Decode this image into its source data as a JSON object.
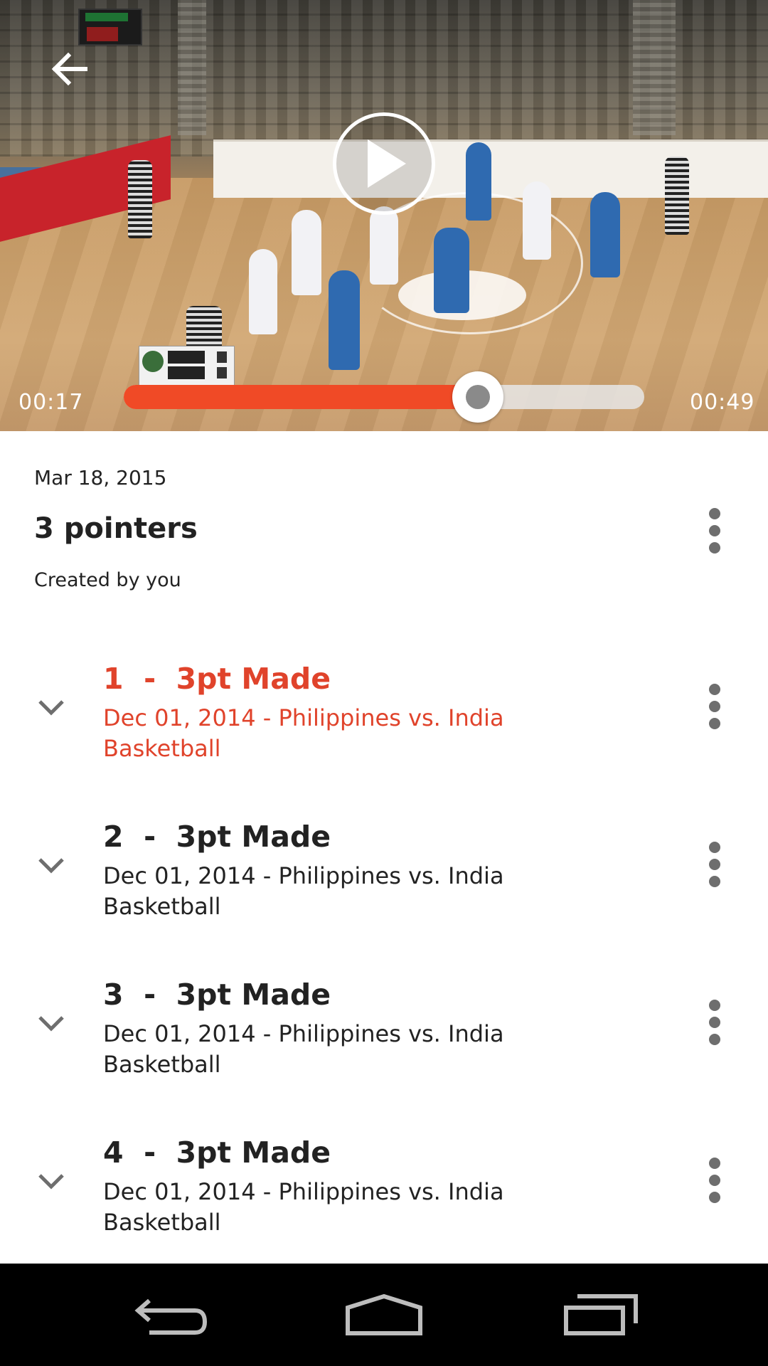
{
  "video": {
    "elapsed": "00:17",
    "duration": "00:49",
    "progress_fraction": 0.68
  },
  "playlist": {
    "date": "Mar 18, 2015",
    "title": "3 pointers",
    "creator": "Created by you"
  },
  "clips": [
    {
      "title": "1  -  3pt Made",
      "subtitle": "Dec 01, 2014 - Philippines vs. India Basketball",
      "active": true
    },
    {
      "title": "2  -  3pt Made",
      "subtitle": "Dec 01, 2014 - Philippines vs. India Basketball",
      "active": false
    },
    {
      "title": "3  -  3pt Made",
      "subtitle": "Dec 01, 2014 - Philippines vs. India Basketball",
      "active": false
    },
    {
      "title": "4  -  3pt Made",
      "subtitle": "Dec 01, 2014 - Philippines vs. India Basketball",
      "active": false
    }
  ],
  "colors": {
    "accent": "#f04a26",
    "active_text": "#e0432b",
    "text": "#222222",
    "icon_gray": "#6e6e6e",
    "nav_bg": "#000000"
  },
  "icons": {
    "back": "arrow-left-icon",
    "play": "play-icon",
    "more": "more-vertical-icon",
    "expand": "chevron-down-icon",
    "nav_back": "nav-back-icon",
    "nav_home": "nav-home-icon",
    "nav_recents": "nav-recents-icon"
  }
}
